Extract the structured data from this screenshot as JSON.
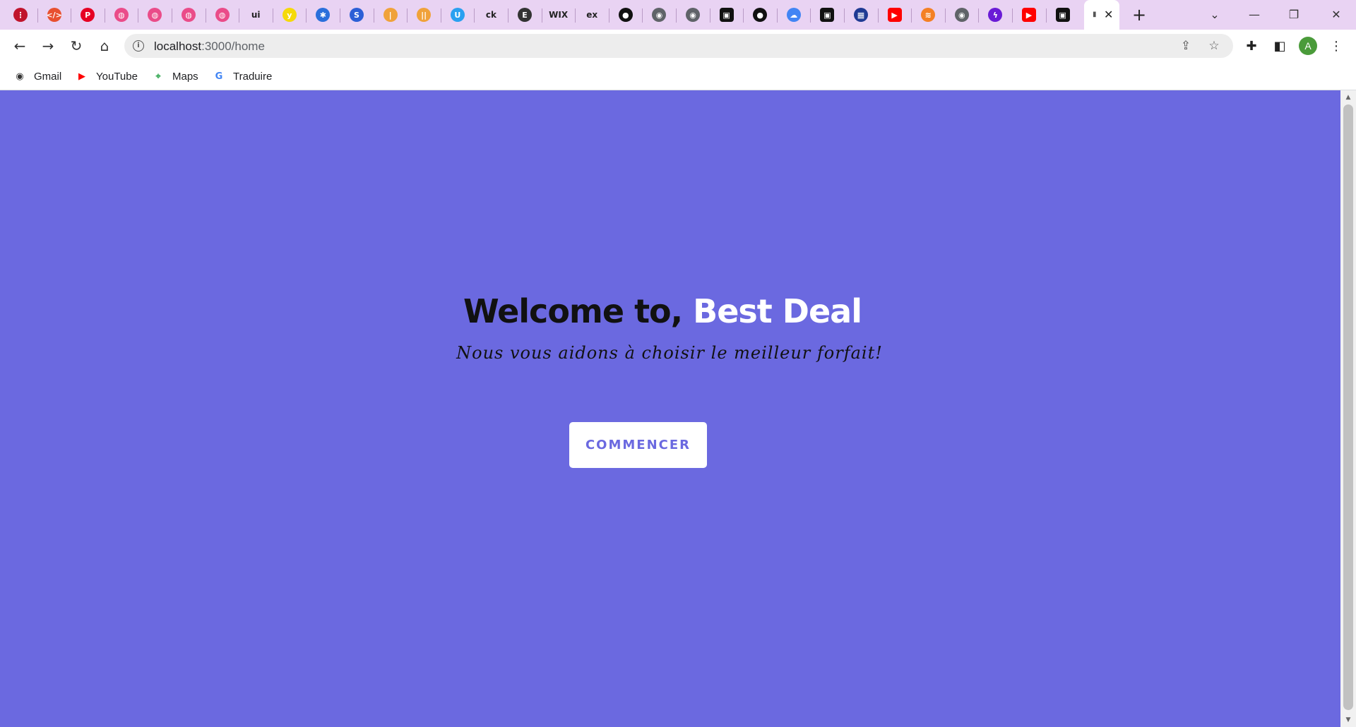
{
  "browser": {
    "tabs": [
      {
        "icon": "dots-icon",
        "color": "#c0142c",
        "glyph": "⋮"
      },
      {
        "icon": "code-icon",
        "color": "#e8502f",
        "glyph": "</>"
      },
      {
        "icon": "pinterest-icon",
        "color": "#e60023",
        "glyph": "P"
      },
      {
        "icon": "dribbble-icon",
        "color": "#ea4c89",
        "glyph": "◍"
      },
      {
        "icon": "dribbble-icon",
        "color": "#ea4c89",
        "glyph": "◍"
      },
      {
        "icon": "dribbble-icon",
        "color": "#ea4c89",
        "glyph": "◍"
      },
      {
        "icon": "dribbble-icon",
        "color": "#ea4c89",
        "glyph": "◍"
      },
      {
        "icon": "ui-icon",
        "color": "#ffffff",
        "glyph": "ui"
      },
      {
        "icon": "y-icon",
        "color": "#f5d90a",
        "glyph": "y"
      },
      {
        "icon": "puzzle-blocks-icon",
        "color": "#2a6fdb",
        "glyph": "✱"
      },
      {
        "icon": "s-icon",
        "color": "#2c5fd6",
        "glyph": "S"
      },
      {
        "icon": "bars-icon",
        "color": "#f0a23a",
        "glyph": "|"
      },
      {
        "icon": "bars-icon",
        "color": "#f0a23a",
        "glyph": "||"
      },
      {
        "icon": "u-icon",
        "color": "#2aa0f0",
        "glyph": "U"
      },
      {
        "icon": "ck-icon",
        "color": "#4b8a4b",
        "glyph": "ck"
      },
      {
        "icon": "e-icon",
        "color": "#333333",
        "glyph": "E"
      },
      {
        "icon": "wix-icon",
        "color": "#000000",
        "glyph": "WIX"
      },
      {
        "icon": "ex-icon",
        "color": "#000000",
        "glyph": "ex"
      },
      {
        "icon": "medium-icon",
        "color": "#000000",
        "glyph": "●"
      },
      {
        "icon": "globe-icon",
        "color": "#5f6368",
        "glyph": "◉"
      },
      {
        "icon": "globe-icon",
        "color": "#5f6368",
        "glyph": "◉"
      },
      {
        "icon": "notion-icon",
        "color": "#000000",
        "glyph": "▣"
      },
      {
        "icon": "github-icon",
        "color": "#000000",
        "glyph": "●"
      },
      {
        "icon": "google-cloud-icon",
        "color": "#4285f4",
        "glyph": "☁"
      },
      {
        "icon": "notion-icon",
        "color": "#000000",
        "glyph": "▣"
      },
      {
        "icon": "chart-icon",
        "color": "#1f3a93",
        "glyph": "▦"
      },
      {
        "icon": "youtube-icon",
        "color": "#ff0000",
        "glyph": "▶"
      },
      {
        "icon": "stack-icon",
        "color": "#f48024",
        "glyph": "≋"
      },
      {
        "icon": "globe-icon",
        "color": "#5f6368",
        "glyph": "◉"
      },
      {
        "icon": "bolt-icon",
        "color": "#6a1bd6",
        "glyph": "ϟ"
      },
      {
        "icon": "youtube-icon",
        "color": "#ff0000",
        "glyph": "▶"
      },
      {
        "icon": "notion-icon",
        "color": "#000000",
        "glyph": "▣"
      }
    ],
    "active_tab_close": "✕",
    "new_tab": "+",
    "url_host": "localhost",
    "url_path": ":3000/home",
    "bookmarks": [
      {
        "label": "Gmail",
        "icon": "globe-icon",
        "color": "#333333",
        "glyph": "◉"
      },
      {
        "label": "YouTube",
        "icon": "youtube-icon",
        "color": "#ff0000",
        "glyph": "▶"
      },
      {
        "label": "Maps",
        "icon": "maps-icon",
        "color": "#34a853",
        "glyph": "⌖"
      },
      {
        "label": "Traduire",
        "icon": "translate-icon",
        "color": "#4285f4",
        "glyph": "G"
      }
    ],
    "profile_initial": "A"
  },
  "hero": {
    "title_prefix": "Welcome to, ",
    "title_brand": "Best Deal",
    "subtitle": "Nous vous aidons à choisir le meilleur forfait!",
    "cta_label": "COMMENCER"
  },
  "colors": {
    "page_bg": "#6b69e0",
    "brand_text": "#ffffff",
    "cta_text": "#6b69e0"
  }
}
